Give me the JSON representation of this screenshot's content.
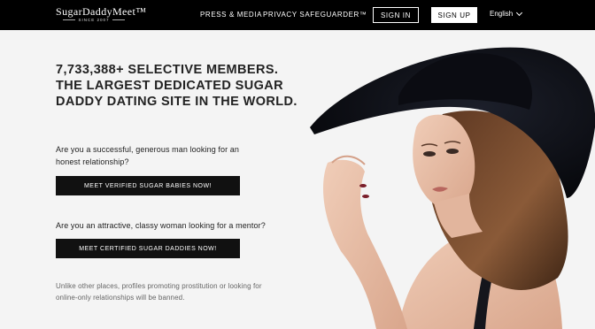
{
  "header": {
    "logo_text": "SugarDaddyMeet™",
    "logo_since": "SINCE 2007",
    "nav": [
      "PRESS & MEDIA",
      "PRIVACY SAFEGUARDER™"
    ],
    "signin_label": "SIGN IN",
    "signup_label": "SIGN UP",
    "language": "English"
  },
  "hero": {
    "headline": "7,733,388+ SELECTIVE MEMBERS. THE LARGEST DEDICATED SUGAR DADDY DATING SITE IN THE WORLD.",
    "question_men": "Are you a successful, generous man looking for an honest relationship?",
    "cta_men": "MEET VERIFIED SUGAR BABIES NOW!",
    "question_women": "Are you an attractive, classy woman looking for a mentor?",
    "cta_women": "MEET CERTIFIED SUGAR DADDIES NOW!",
    "disclaimer": "Unlike other places, profiles promoting prostitution or looking for online-only relationships will be banned."
  },
  "colors": {
    "header_bg": "#000000",
    "page_bg": "#f4f4f4",
    "button_bg": "#111111"
  }
}
